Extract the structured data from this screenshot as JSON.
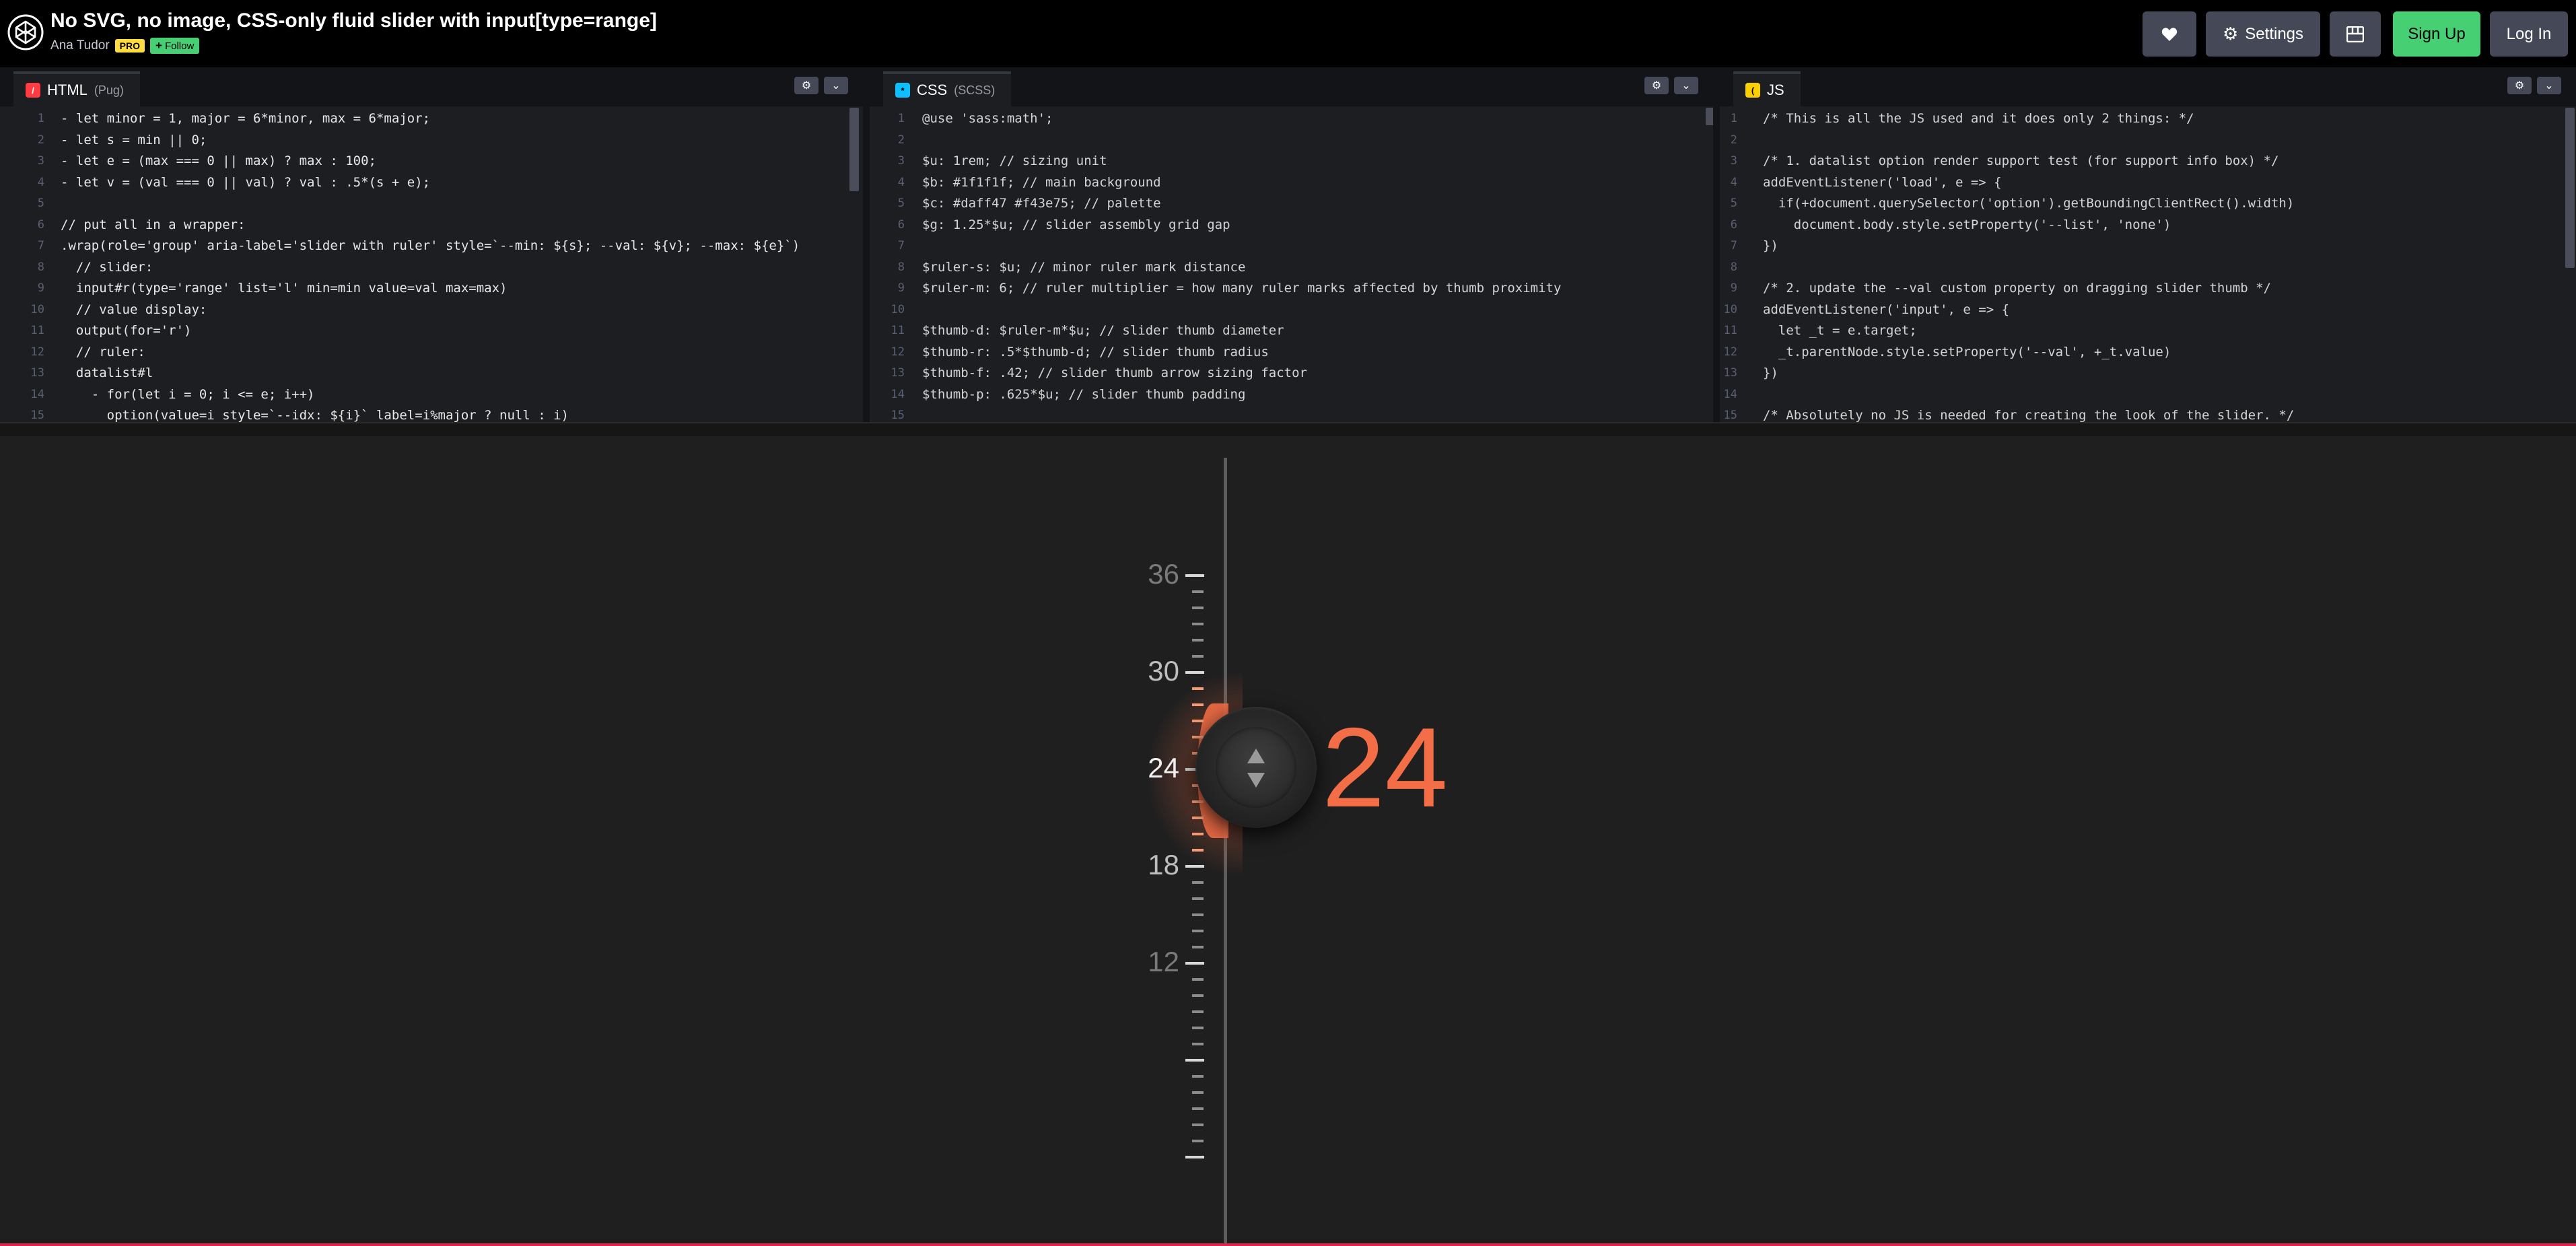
{
  "header": {
    "title": "No SVG, no image, CSS-only fluid slider with input[type=range]",
    "author": "Ana Tudor",
    "pro_badge": "PRO",
    "follow_label": "Follow",
    "settings_label": "Settings",
    "signup_label": "Sign Up",
    "login_label": "Log In"
  },
  "editors": {
    "html": {
      "name": "HTML",
      "sub": "(Pug)",
      "lines": [
        {
          "n": "1",
          "t": "- let minor = 1, major = 6*minor, max = 6*major;"
        },
        {
          "n": "2",
          "t": "- let s = min || 0;"
        },
        {
          "n": "3",
          "t": "- let e = (max === 0 || max) ? max : 100;"
        },
        {
          "n": "4",
          "t": "- let v = (val === 0 || val) ? val : .5*(s + e);"
        },
        {
          "n": "5",
          "t": ""
        },
        {
          "n": "6",
          "t": "// put all in a wrapper:"
        },
        {
          "n": "7",
          "t": ".wrap(role='group' aria-label='slider with ruler' style=`--min: ${s}; --val: ${v}; --max: ${e}`)"
        },
        {
          "n": "8",
          "t": "  // slider:"
        },
        {
          "n": "9",
          "t": "  input#r(type='range' list='l' min=min value=val max=max)"
        },
        {
          "n": "10",
          "t": "  // value display:"
        },
        {
          "n": "11",
          "t": "  output(for='r')"
        },
        {
          "n": "12",
          "t": "  // ruler:"
        },
        {
          "n": "13",
          "t": "  datalist#l"
        },
        {
          "n": "14",
          "t": "    - for(let i = 0; i <= e; i++)"
        },
        {
          "n": "15",
          "t": "      option(value=i style=`--idx: ${i}` label=i%major ? null : i)"
        }
      ]
    },
    "css": {
      "name": "CSS",
      "sub": "(SCSS)",
      "lines": [
        {
          "n": "1",
          "t": "@use 'sass:math';"
        },
        {
          "n": "2",
          "t": ""
        },
        {
          "n": "3",
          "t": "$u: 1rem; // sizing unit"
        },
        {
          "n": "4",
          "t": "$b: #1f1f1f; // main background"
        },
        {
          "n": "5",
          "t": "$c: #daff47 #f43e75; // palette"
        },
        {
          "n": "6",
          "t": "$g: 1.25*$u; // slider assembly grid gap"
        },
        {
          "n": "7",
          "t": ""
        },
        {
          "n": "8",
          "t": "$ruler-s: $u; // minor ruler mark distance"
        },
        {
          "n": "9",
          "t": "$ruler-m: 6; // ruler multiplier = how many ruler marks affected by thumb proximity"
        },
        {
          "n": "10",
          "t": ""
        },
        {
          "n": "11",
          "t": "$thumb-d: $ruler-m*$u; // slider thumb diameter"
        },
        {
          "n": "12",
          "t": "$thumb-r: .5*$thumb-d; // slider thumb radius"
        },
        {
          "n": "13",
          "t": "$thumb-f: .42; // slider thumb arrow sizing factor"
        },
        {
          "n": "14",
          "t": "$thumb-p: .625*$u; // slider thumb padding"
        },
        {
          "n": "15",
          "t": ""
        }
      ]
    },
    "js": {
      "name": "JS",
      "sub": "",
      "lines": [
        {
          "n": "1",
          "t": "/* This is all the JS used and it does only 2 things: */"
        },
        {
          "n": "2",
          "t": ""
        },
        {
          "n": "3",
          "t": "/* 1. datalist option render support test (for support info box) */"
        },
        {
          "n": "4",
          "t": "addEventListener('load', e => {"
        },
        {
          "n": "5",
          "t": "  if(+document.querySelector('option').getBoundingClientRect().width)"
        },
        {
          "n": "6",
          "t": "    document.body.style.setProperty('--list', 'none')"
        },
        {
          "n": "7",
          "t": "})"
        },
        {
          "n": "8",
          "t": ""
        },
        {
          "n": "9",
          "t": "/* 2. update the --val custom property on dragging slider thumb */"
        },
        {
          "n": "10",
          "t": "addEventListener('input', e => {"
        },
        {
          "n": "11",
          "t": "  let _t = e.target;"
        },
        {
          "n": "12",
          "t": "  _t.parentNode.style.setProperty('--val', +_t.value)"
        },
        {
          "n": "13",
          "t": "})"
        },
        {
          "n": "14",
          "t": ""
        },
        {
          "n": "15",
          "t": "/* Absolutely no JS is needed for creating the look of the slider. */"
        }
      ]
    }
  },
  "preview": {
    "slider_value": 24,
    "slider_min": 0,
    "slider_max": 36,
    "output_value": "24",
    "accent_color": "#f36e46",
    "ruler_labels": [
      "36",
      "30",
      "24",
      "18",
      "12"
    ]
  },
  "icons": {
    "logo": "codepen-logo-icon",
    "heart": "heart-icon",
    "settings": "gear-icon",
    "layout": "layout-grid-icon",
    "follow": "plus-icon",
    "pane_settings": "gear-icon",
    "pane_collapse": "chevron-down-icon",
    "thumb": "up-down-arrows-icon"
  }
}
